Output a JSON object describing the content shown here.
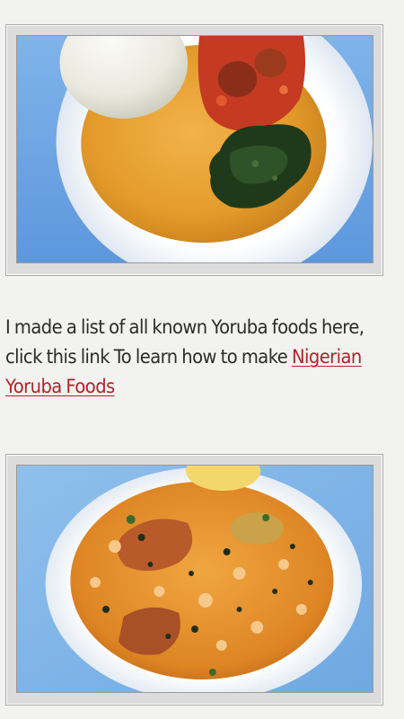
{
  "article": {
    "images": [
      {
        "subject": "Pounded yam with egusi soup, stew and vegetables"
      },
      {
        "subject": "Yoruba seafood ofada style stew in white bowl"
      }
    ],
    "paragraph_text": "I made a list of all known Yoruba foods here, click this link To learn how to make ",
    "link_text": "Nigerian Yoruba Foods",
    "link_color": "#b0232a",
    "text_color": "#2b2b2b",
    "background_color": "#f2f2f0"
  }
}
